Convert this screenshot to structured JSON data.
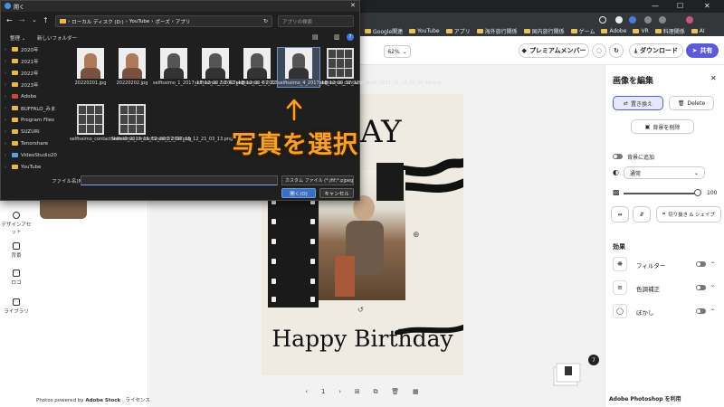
{
  "chrome": {
    "bookmarks": [
      "Google関連",
      "YouTube",
      "アプリ",
      "海外旅行関係",
      "国内旅行関係",
      "ゲーム",
      "Adobe",
      "VR",
      "料理関係",
      "AI"
    ]
  },
  "app_header": {
    "zoom": "62%",
    "premium_label": "プレミアムメンバー",
    "download_label": "ダウンロード",
    "send_label": "共有"
  },
  "left_rail": {
    "items": [
      "デザインアセット",
      "背景",
      "ロゴ",
      "ライブラリ"
    ]
  },
  "credit": {
    "prefix": "Photos powered by ",
    "brand": "Adobe Stock",
    "suffix": " : ライセンス情報"
  },
  "canvas": {
    "top_text": "AY",
    "birthday_text": "Happy Birthday",
    "page_number": "1",
    "page_badge": "7"
  },
  "right_panel": {
    "title": "画像を編集",
    "replace_label": "置き換え",
    "delete_label": "Delete",
    "remove_bg_label": "背景を削除",
    "add_to_bg_label": "背景に追加",
    "blend_mode": "通常",
    "opacity_value": "100",
    "crop_label": "切り抜き & シェイプ",
    "effects_title": "効果",
    "effects": [
      "フィルター",
      "色調補正",
      "ぼかし"
    ],
    "footer": "Adobe Photoshop を利用"
  },
  "dialog": {
    "title": "開く",
    "path": [
      "ローカル ディスク (D:)",
      "YouTube",
      "ポーズ",
      "アプリ"
    ],
    "search_placeholder": "アプリの検索",
    "organize": "整理",
    "new_folder": "新しいフォルダー",
    "sidebar": [
      "2020年",
      "2021年",
      "2022年",
      "2023年",
      "Adobe",
      "BUFFALO_みま",
      "Program Files",
      "SUZURI",
      "Tenorshare",
      "VideoStudio20",
      "YouTube"
    ],
    "files": [
      {
        "name": "20220201.jpg",
        "kind": "color"
      },
      {
        "name": "20220202.jpg",
        "kind": "color"
      },
      {
        "name": "selfissimo_1_2017_15_12_20_58_42.png",
        "kind": "bw"
      },
      {
        "name": "selfissimo_2_2017_15_12_20_37_22.png",
        "kind": "bw"
      },
      {
        "name": "selfissimo_4_2017_15_12_20_34_32.png",
        "kind": "bw"
      },
      {
        "name": "selfissimo_4_2017_15_12_20_37_12.png",
        "kind": "bw"
      },
      {
        "name": "selfissimo_contactSheet0_2017_15_12_20_26_14.png",
        "kind": "grid"
      },
      {
        "name": "selfissimo_contactSheet0_2017_15_12_20_37_04.png",
        "kind": "grid"
      },
      {
        "name": "selfissimo_contactSheet0_2017_15_12_21_03_13.png",
        "kind": "grid"
      }
    ],
    "filename_label": "ファイル名(N):",
    "filetype": "カスタム ファイル (*.jfif;*.pjpeg;*.jp",
    "open_label": "開く(O)",
    "cancel_label": "キャンセル"
  },
  "annotation": {
    "text": "写真を選択"
  },
  "colors": {
    "accent": "#5b5bd6",
    "annotation": "#f7a12c"
  }
}
